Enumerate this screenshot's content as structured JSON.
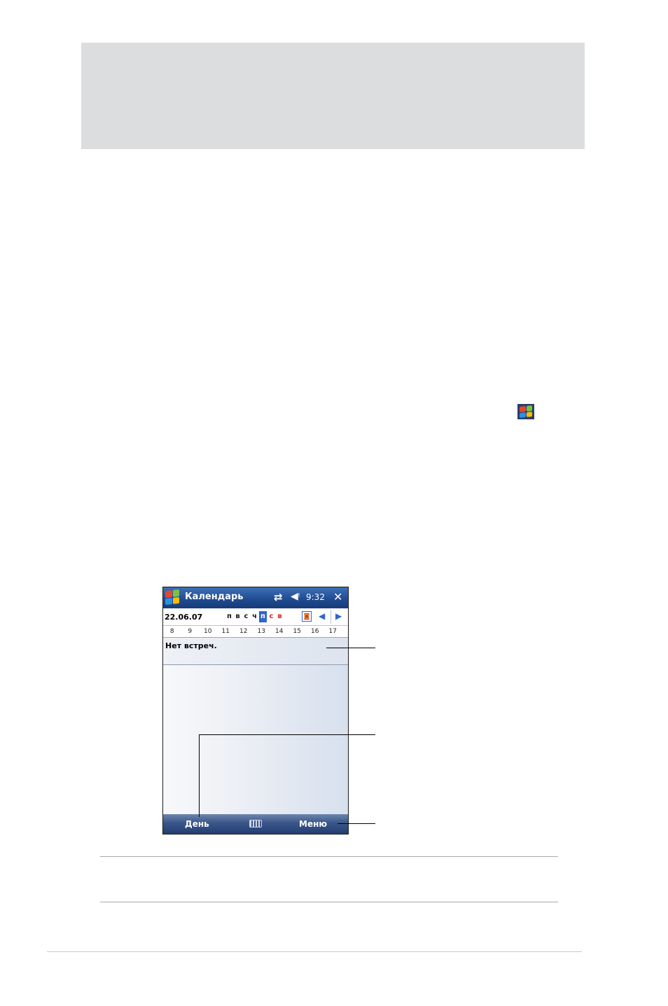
{
  "device": {
    "title": "Календарь",
    "time": "9:32",
    "close_label": "✕",
    "date": "22.06.07",
    "weekdays": [
      {
        "label": "п",
        "state": "normal"
      },
      {
        "label": "в",
        "state": "normal"
      },
      {
        "label": "с",
        "state": "normal"
      },
      {
        "label": "ч",
        "state": "normal"
      },
      {
        "label": "п",
        "state": "selected"
      },
      {
        "label": "с",
        "state": "weekend"
      },
      {
        "label": "в",
        "state": "weekend"
      }
    ],
    "hours": [
      "8",
      "9",
      "10",
      "11",
      "12",
      "13",
      "14",
      "15",
      "16",
      "17"
    ],
    "no_appointments": "Нет встреч.",
    "softkey_left": "День",
    "softkey_right": "Меню"
  },
  "icons": {
    "start": "windows-start-icon",
    "connectivity": "connectivity-icon",
    "volume": "volume-icon",
    "today": "calendar-today-icon",
    "prev": "arrow-left-icon",
    "next": "arrow-right-icon",
    "keyboard": "keyboard-icon"
  },
  "colors": {
    "header_band": "#dcdddf",
    "titlebar": "#1f4a8f",
    "selected_day": "#2f66c8",
    "weekend_day": "#e02020"
  }
}
